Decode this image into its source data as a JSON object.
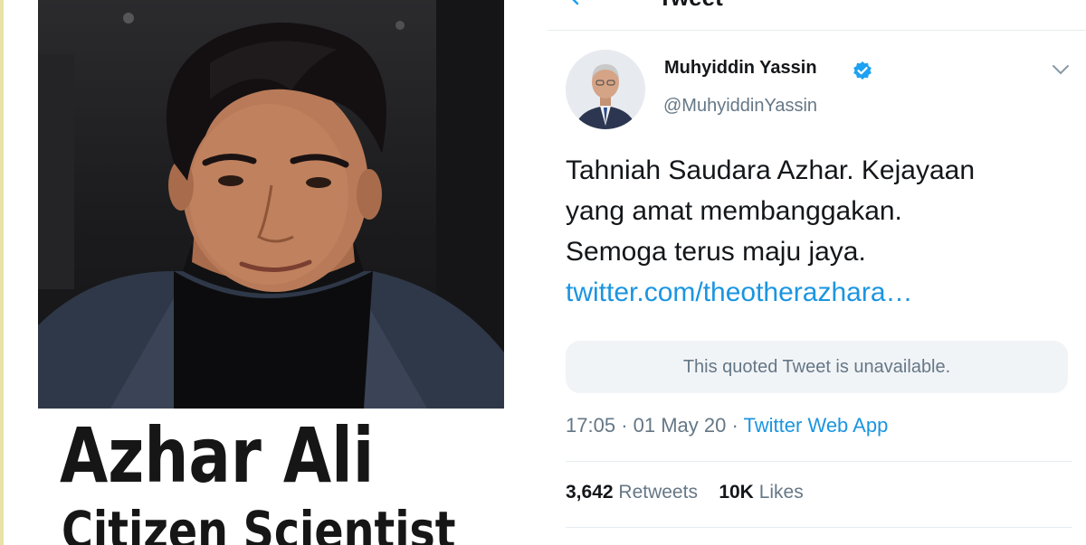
{
  "poster": {
    "name": "Azhar Ali",
    "role": "Citizen Scientist"
  },
  "tweet": {
    "header_title": "Tweet",
    "author_name": "Muhyiddin Yassin",
    "author_handle": "@MuhyiddinYassin",
    "verified": true,
    "text_lines": [
      "Tahniah Saudara Azhar. Kejayaan",
      "yang amat membanggakan.",
      "Semoga terus maju jaya."
    ],
    "link_text": "twitter.com/theotherazhara…",
    "quoted_text": "This quoted Tweet is unavailable.",
    "time": "17:05",
    "date": "01 May 20",
    "source": "Twitter Web App",
    "separator": "·",
    "retweets_count": "3,642",
    "retweets_label": "Retweets",
    "likes_count": "10K",
    "likes_label": "Likes"
  },
  "icons": {
    "verified": "verified-badge-icon",
    "caret": "chevron-down-icon",
    "back": "back-arrow-icon"
  },
  "colors": {
    "link": "#1b95e0",
    "secondary_text": "#657786",
    "primary_text": "#14171a",
    "quote_bg": "#f1f4f7",
    "verified": "#1da1f2"
  }
}
